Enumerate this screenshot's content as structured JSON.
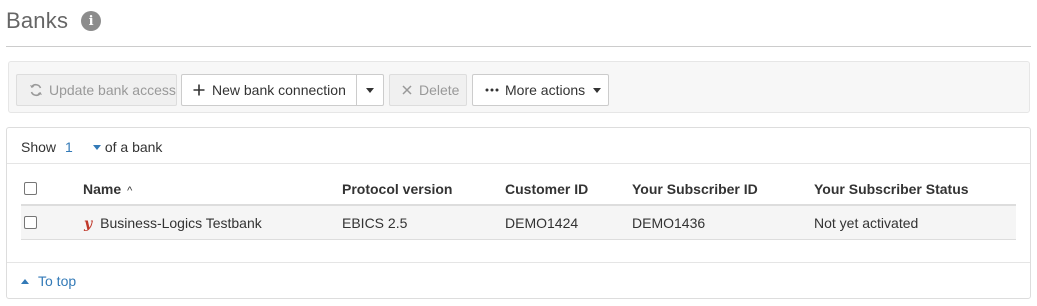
{
  "header": {
    "title": "Banks",
    "info_icon": "info-icon"
  },
  "toolbar": {
    "update_label": "Update bank access",
    "new_label": "New bank connection",
    "delete_label": "Delete",
    "more_label": "More actions"
  },
  "panel": {
    "show_prefix": "Show",
    "show_count": "1",
    "show_suffix": "of a bank",
    "to_top": "To top"
  },
  "table": {
    "columns": [
      "Name",
      "Protocol version",
      "Customer ID",
      "Your Subscriber ID",
      "Your Subscriber Status"
    ],
    "sort_indicator": "^",
    "rows": [
      {
        "icon": "y",
        "name": "Business-Logics Testbank",
        "protocol": "EBICS 2.5",
        "customer_id": "DEMO1424",
        "subscriber_id": "DEMO1436",
        "status": "Not yet activated"
      }
    ]
  },
  "colors": {
    "accent": "#337ab7",
    "bank_icon": "#c0392b",
    "title": "#666666"
  }
}
